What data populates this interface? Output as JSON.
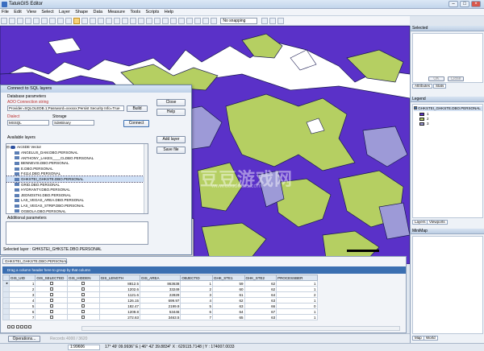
{
  "window": {
    "title": "TatukGIS Editor"
  },
  "menu": [
    "File",
    "Edit",
    "View",
    "Select",
    "Layer",
    "Shape",
    "Data",
    "Measure",
    "Tools",
    "Scripts",
    "Help"
  ],
  "toolbar": {
    "snapping": "No snapping"
  },
  "dialog": {
    "title": "Connect to SQL layers",
    "section_label": "Database parameters",
    "ado_label": "ADO Connection string",
    "ado_value": "Provider=SQLOLEDB.1;Password=xxxxxx;Persist Security Info=True",
    "build_label": "Build",
    "dialect_label": "Dialect",
    "dialect_value": "MSSQL",
    "storage_label": "Storage",
    "storage_value": "SdeBinary",
    "connect_label": "Connect",
    "close_label": "Close",
    "help_label": "Help",
    "add_layer_label": "Add layer",
    "save_file_label": "Save file",
    "available_label": "Available layers",
    "root_label": "ArcSDE Vector",
    "layers": [
      "ANGELUS_DAM.DBO.PERSONAL",
      "ANTHONY_LAKES____CLDBO.PERSONAL",
      "BENNEVIS.DBO.PERSONAL",
      "E.DBO.PERSONAL",
      "F4114.DBO.PERSONAL",
      "GHKSTEI_GHKSTE.DBO.PERSONAL",
      "GRID.DBO.PERSONAL",
      "HYDRANTY.DBO.PERSONAL",
      "JEDNOSTKI.DBO.PERSONAL",
      "LAS_VEGAS_AREA.DBO.PERSONAL",
      "LAS_VEGAS_STRIP.DBO.PERSONAL",
      "OGBOLA.DBO.PERSONAL"
    ],
    "selected_index": 5,
    "additional_label": "Additional parameters",
    "selected_status": "Selected layer : GHKSTEI_GHKSTE.DBO.PERSONAL"
  },
  "right_panel": {
    "selected_title": "Selected",
    "ok_label": "OK",
    "close_label": "Close",
    "attrib_tab": "Attributes",
    "stats_tab": "Stats",
    "legend_title": "Legend",
    "legend_layer": "GHKSTEI_GHKSTE.DBO.PERSONAL",
    "legend_items": [
      "1",
      "2",
      "3"
    ],
    "layers_tab": "Layers",
    "viewports_tab": "Viewports",
    "minimap_title": "MiniMap",
    "map_tab": "Map",
    "world_tab": "World"
  },
  "grid": {
    "tab": "GHKSTEI_GHKSTE.DBO.PERSONAL",
    "groupbar": "Drag a column header here to group by that column",
    "columns": [
      "GIS_UID",
      "GIS_SELECTED",
      "GIS_HIDDEN",
      "GIS_LENGTH",
      "GIS_AREA",
      "OBJECTID",
      "GHK_STE1",
      "GHK_STE2",
      "PROCESSBER"
    ],
    "rows": [
      [
        "1",
        "",
        "",
        "8812.5",
        "863638",
        "1",
        "59",
        "62",
        "1"
      ],
      [
        "2",
        "",
        "",
        "1202.6",
        "33249",
        "2",
        "60",
        "62",
        "1"
      ],
      [
        "3",
        "",
        "",
        "1121.6",
        "22829",
        "3",
        "61",
        "64",
        "2"
      ],
      [
        "4",
        "",
        "",
        "126.15",
        "699.97",
        "4",
        "62",
        "63",
        "1"
      ],
      [
        "5",
        "",
        "",
        "182.47",
        "2199.9",
        "5",
        "63",
        "66",
        "0"
      ],
      [
        "6",
        "",
        "",
        "1209.8",
        "53446",
        "6",
        "64",
        "67",
        "1"
      ],
      [
        "7",
        "",
        "",
        "272.63",
        "3463.5",
        "7",
        "65",
        "63",
        "1"
      ]
    ],
    "nav_record": "Records 4000 / 3620"
  },
  "operations_label": "Operations...",
  "status": {
    "scale": "1:99606",
    "coords": "17° 49' 09.9936\" E | 46° 42' 39.8834\" X : 629115.7148 | Y : 174007.0033"
  },
  "watermark": "豆豆游戏网",
  "watermark_url": "www.doudouzs.com",
  "colors": {
    "purple": "#5a31c8",
    "green": "#b5cf62",
    "lavender": "#9d9ad7",
    "accent": "#3b6fb1"
  }
}
